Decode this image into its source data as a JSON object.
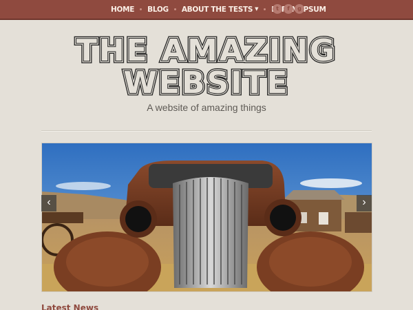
{
  "nav": {
    "items": [
      {
        "label": "HOME"
      },
      {
        "label": "BLOG"
      },
      {
        "label": "ABOUT THE TESTS"
      },
      {
        "label": "LOREM IPSUM"
      }
    ],
    "social": [
      "t",
      "f",
      "g"
    ]
  },
  "header": {
    "title_line1": "THE AMAZING",
    "title_line2": "WEBSITE",
    "tagline": "A website of amazing things"
  },
  "slider": {
    "prev": "‹",
    "next": "›"
  },
  "section": {
    "latest": "Latest News"
  },
  "colors": {
    "topbar": "#8f4a3f",
    "background": "#e4e0d8"
  }
}
